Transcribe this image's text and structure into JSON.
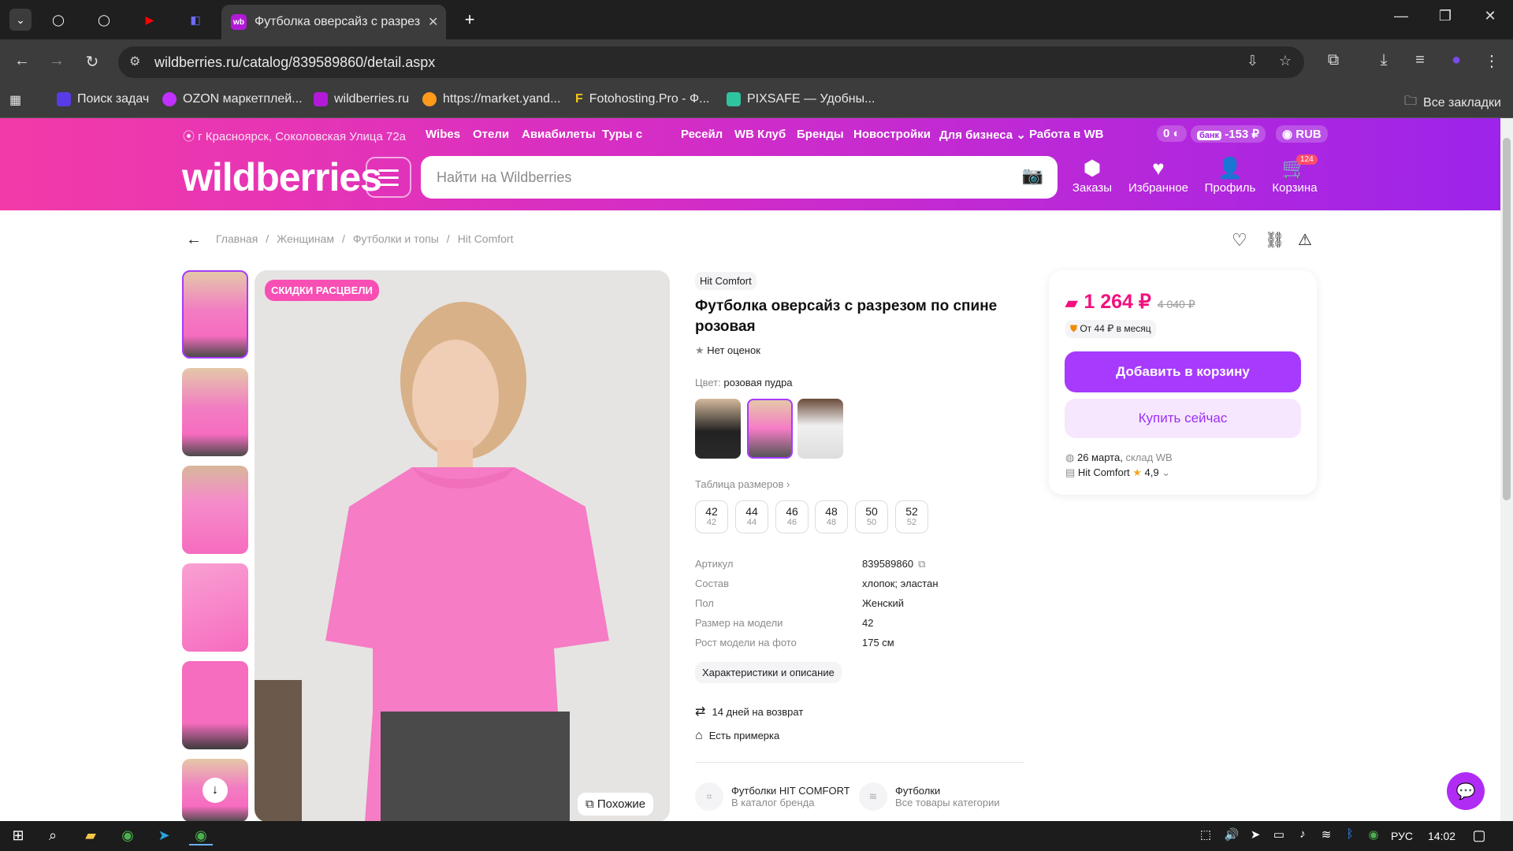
{
  "browser": {
    "active_tab_title": "Футболка оверсайз с разрезом",
    "active_tab_favicon": "wb",
    "url": "wildberries.ru/catalog/839589860/detail.aspx",
    "bookmarks": [
      "Поиск задач",
      "OZON маркетплей...",
      "wildberries.ru",
      "https://market.yand...",
      "Fotohosting.Pro - Ф...",
      "PIXSAFE — Удобны..."
    ],
    "all_bookmarks": "Все закладки"
  },
  "header": {
    "location": "г Красноярск, Соколовская Улица 72а",
    "nav": [
      "Wibes",
      "Отели",
      "Авиабилеты",
      "Туры с",
      "Ресейл",
      "WB Клуб",
      "Бренды",
      "Новостройки",
      "Для бизнеса",
      "Работа в WB"
    ],
    "wallet": "0",
    "bank_label": "банк",
    "bank_value": "-153 ₽",
    "currency": "RUB",
    "logo": "wildberries",
    "search_placeholder": "Найти на Wildberries",
    "orders": "Заказы",
    "favorites": "Избранное",
    "profile": "Профиль",
    "cart": "Корзина",
    "cart_count": "124"
  },
  "breadcrumb": [
    "Главная",
    "Женщинам",
    "Футболки и топы",
    "Hit Comfort"
  ],
  "product": {
    "badge": "СКИДКИ РАСЦВЕЛИ",
    "similar": "Похожие",
    "brand": "Hit Comfort",
    "title": "Футболка оверсайз с разрезом по спине розовая",
    "rating": "Нет оценок",
    "color_label": "Цвет:",
    "color_value": "розовая пудра",
    "size_table": "Таблица размеров",
    "sizes": [
      {
        "main": "42",
        "sub": "42"
      },
      {
        "main": "44",
        "sub": "44"
      },
      {
        "main": "46",
        "sub": "46"
      },
      {
        "main": "48",
        "sub": "48"
      },
      {
        "main": "50",
        "sub": "50"
      },
      {
        "main": "52",
        "sub": "52"
      }
    ],
    "specs": [
      {
        "k": "Артикул",
        "v": "839589860"
      },
      {
        "k": "Состав",
        "v": "хлопок; эластан"
      },
      {
        "k": "Пол",
        "v": "Женский"
      },
      {
        "k": "Размер на модели",
        "v": "42"
      },
      {
        "k": "Рост модели на фото",
        "v": "175 см"
      }
    ],
    "desc_button": "Характеристики и описание",
    "returns": "14 дней на возврат",
    "fitting": "Есть примерка",
    "brand_link_title": "Футболки HIT COMFORT",
    "brand_link_sub": "В каталог бренда",
    "cat_link_title": "Футболки",
    "cat_link_sub": "Все товары категории"
  },
  "price": {
    "current": "1 264 ₽",
    "old": "4 040 ₽",
    "installment": "От 44 ₽ в месяц",
    "add_to_cart": "Добавить в корзину",
    "buy_now": "Купить сейчас",
    "delivery_date": "26 марта,",
    "delivery_warehouse": "склад WB",
    "seller": "Hit Comfort",
    "seller_rating": "4,9"
  },
  "taskbar": {
    "lang": "РУС",
    "time": "14:02"
  },
  "colors": {
    "accent": "#a73afd",
    "price": "#f1117e",
    "header_start": "#f33aa8",
    "header_end": "#9d24ea"
  }
}
